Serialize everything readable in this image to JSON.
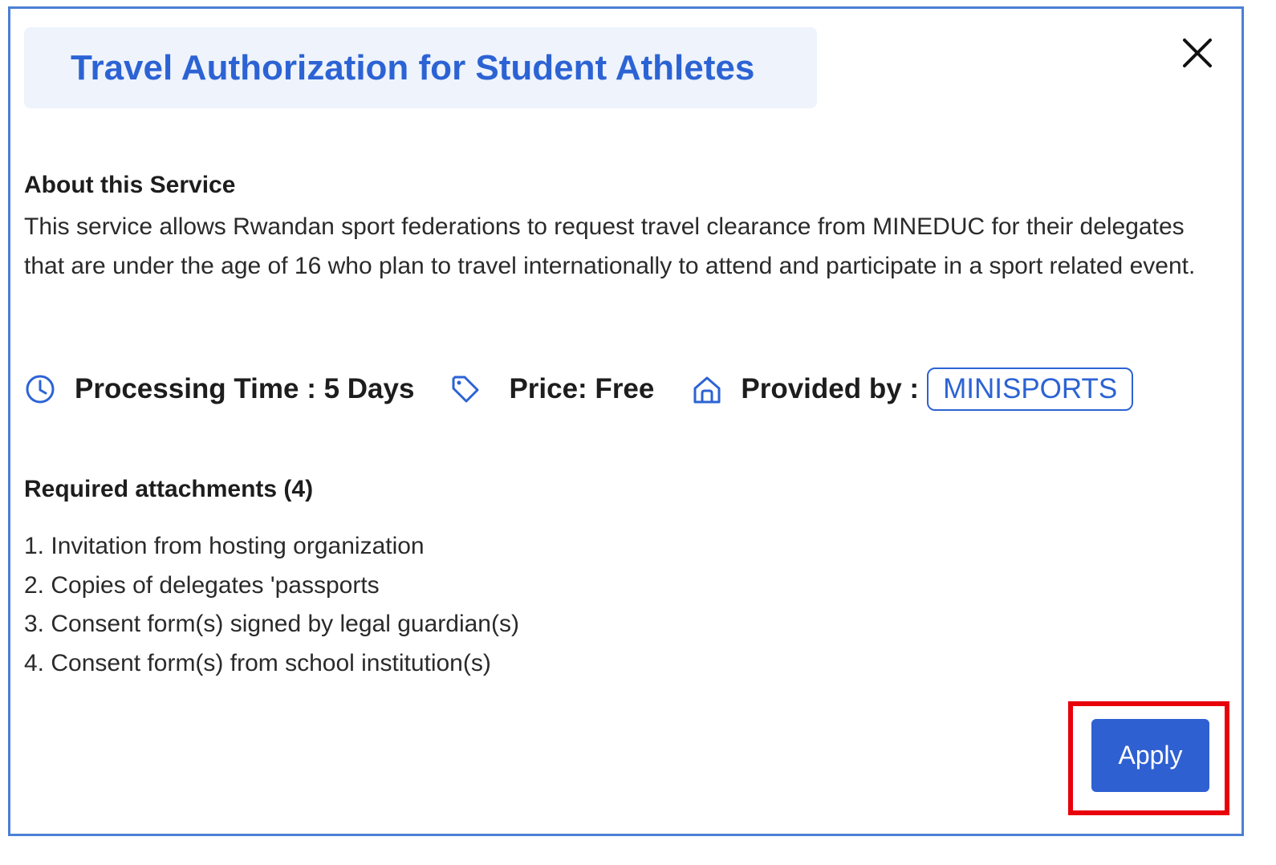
{
  "modal": {
    "title": "Travel Authorization for Student Athletes",
    "close_icon": "close-icon"
  },
  "about": {
    "heading": "About this Service",
    "description": "This service allows Rwandan sport federations to request travel clearance from MINEDUC for their delegates that are under the age of 16 who plan to travel internationally to attend and participate in a sport related event."
  },
  "meta": {
    "processing_icon": "clock-icon",
    "processing_label": "Processing Time : 5 Days",
    "price_icon": "tag-icon",
    "price_label": "Price: Free",
    "provider_icon": "home-icon",
    "provider_label": "Provided by :",
    "provider_name": "MINISPORTS"
  },
  "attachments": {
    "heading": "Required attachments (4)",
    "items": [
      "1. Invitation from hosting organization",
      "2. Copies of delegates 'passports",
      "3. Consent form(s) signed by legal guardian(s)",
      "4. Consent form(s) from school institution(s)"
    ]
  },
  "actions": {
    "apply_label": "Apply"
  },
  "colors": {
    "accent": "#2c63d4",
    "title_bg": "#eef3fc",
    "modal_border": "#4a7fd6",
    "highlight": "#e8000a",
    "apply_bg": "#2f60d2"
  }
}
